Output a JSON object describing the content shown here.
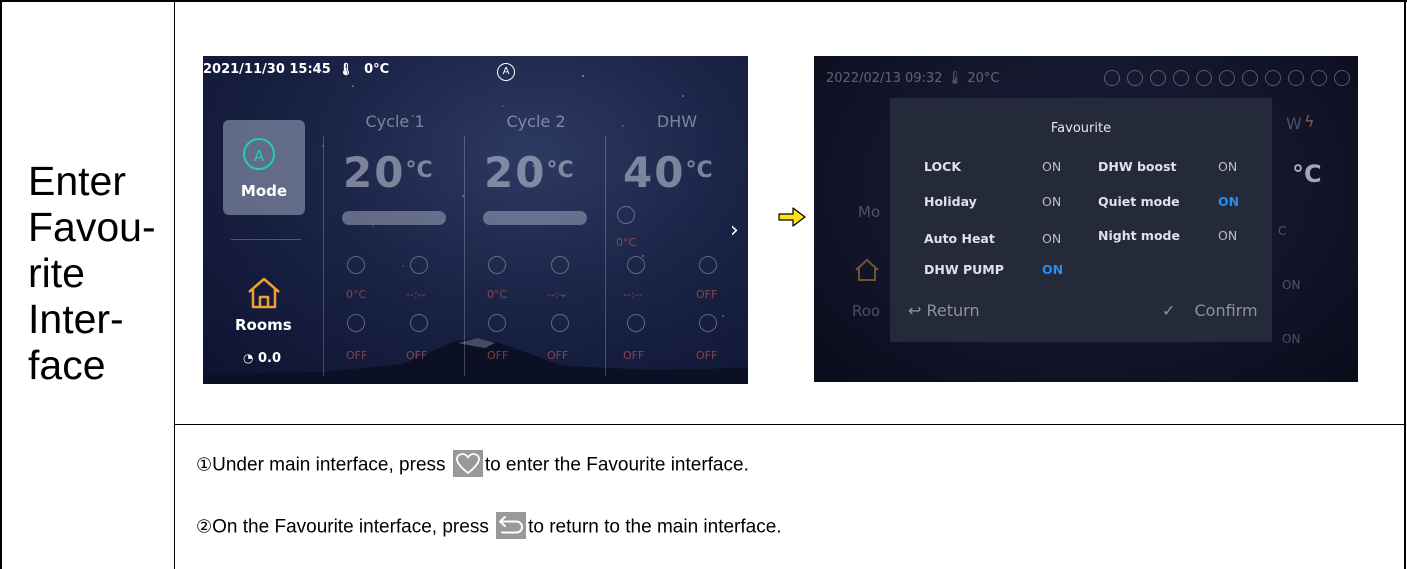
{
  "row_label": [
    "Enter",
    "Favou-",
    "rite",
    "Inter-",
    "face"
  ],
  "main_screen": {
    "datetime": "2021/11/30 15:45",
    "outdoor_temp": "0°C",
    "auto_symbol": "A",
    "mode_label": "Mode",
    "rooms_label": "Rooms",
    "meter_value": "0.0",
    "columns": [
      {
        "title": "Cycle 1",
        "temp": "20",
        "unit": "°C"
      },
      {
        "title": "Cycle 2",
        "temp": "20",
        "unit": "°C"
      },
      {
        "title": "DHW",
        "temp": "40",
        "unit": "°C",
        "sub": "0°C"
      }
    ],
    "small_values": [
      "0°C",
      "--:--",
      "0°C",
      "--:--",
      "--:--",
      "OFF",
      "OFF",
      "OFF",
      "OFF",
      "OFF",
      "OFF",
      "OFF"
    ]
  },
  "favourite_screen": {
    "datetime": "2022/02/13 09:32",
    "temp": "20°C",
    "title": "Favourite",
    "items": [
      {
        "label": "LOCK",
        "value": "ON",
        "active": false
      },
      {
        "label": "DHW boost",
        "value": "ON",
        "active": false
      },
      {
        "label": "Holiday",
        "value": "ON",
        "active": false
      },
      {
        "label": "Quiet mode",
        "value": "ON",
        "active": true
      },
      {
        "label": "Auto Heat",
        "value": "ON",
        "active": false
      },
      {
        "label": "Night mode",
        "value": "ON",
        "active": false
      },
      {
        "label": "DHW PUMP",
        "value": "ON",
        "active": true
      }
    ],
    "return_label": "Return",
    "confirm_label": "Confirm",
    "bg_fragments": {
      "mode": "Mo",
      "rooms": "Roo",
      "unit": "°C",
      "dhw": "W",
      "on1": "ON",
      "on2": "ON",
      "c": "C"
    }
  },
  "instructions": [
    {
      "num": "①",
      "before": "Under main interface, press",
      "after": "to enter the Favourite interface.",
      "icon": "heart-icon",
      "icon_color": "#999999"
    },
    {
      "num": "②",
      "before": "On the Favourite interface, press",
      "after": "to return to the main interface.",
      "icon": "return-icon",
      "icon_color": "#999999"
    }
  ],
  "colors": {
    "accent_teal": "#1ED2B4",
    "on_blue": "#2A8DF0",
    "arrow_yellow": "#FFE11A"
  }
}
